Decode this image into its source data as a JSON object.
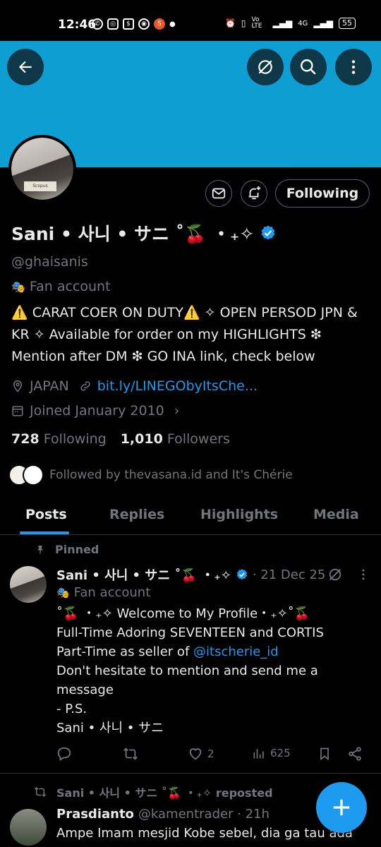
{
  "status_bar": {
    "time": "12:46",
    "network": "4G",
    "lte": "Vo LTE",
    "battery": "55"
  },
  "profile": {
    "display_name": "Sani • 사니 • サニ ˚🍒 ・₊✧",
    "handle": "@ghaisanis",
    "category": "Fan account",
    "bio": "⚠️ CARAT COER ON DUTY⚠️ ✧ OPEN PERSOD JPN & KR ✧ Available for order on my HIGHLIGHTS ❇ Mention after DM ❇ GO INA link, check below",
    "location": "JAPAN",
    "link": "bit.ly/LINEGObyItsChe...",
    "joined": "Joined January 2010",
    "following_count": "728",
    "following_label": "Following",
    "followers_count": "1,010",
    "followers_label": "Followers",
    "followed_by": "Followed by thevasana.id and It's Chérie",
    "follow_button": "Following"
  },
  "tabs": [
    {
      "label": "Posts"
    },
    {
      "label": "Replies"
    },
    {
      "label": "Highlights"
    },
    {
      "label": "Media"
    }
  ],
  "pinned_tweet": {
    "pinned_label": "Pinned",
    "name": "Sani • 사니 • サニ ˚🍒 ・₊✧",
    "date": "· 21 Dec 25",
    "category": "Fan account",
    "line1": "˚🍒 ・₊✧ Welcome to My Profile・₊✧˚🍒",
    "line2": "Full-Time Adoring SEVENTEEN and CORTIS",
    "line3_prefix": "Part-Time as seller of ",
    "line3_mention": "@itscherie_id",
    "line4": "Don't hesitate to mention and send me a message",
    "line5": "- P.S.",
    "line6": "Sani • 사니 • サニ",
    "likes": "2",
    "views": "625"
  },
  "repost_tweet": {
    "repost_label": "Sani • 사니 • サニ ˚🍒 ・₊✧ reposted",
    "name": "Prasdianto",
    "meta": "@kamentrader · 21h",
    "text": "Ampe Imam mesjid Kobe sebel, dia ga tau ada"
  },
  "colors": {
    "banner": "#0d9ed3",
    "accent": "#1d9bf0",
    "muted": "#71767b"
  }
}
